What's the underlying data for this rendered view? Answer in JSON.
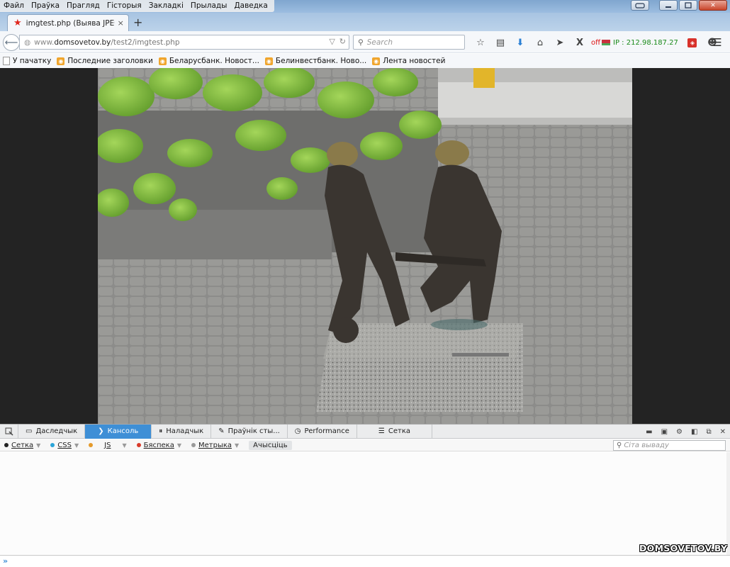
{
  "menu": {
    "items": [
      "Файл",
      "Праўка",
      "Прагляд",
      "Гісторыя",
      "Закладкі",
      "Прылады",
      "Даведка"
    ]
  },
  "tab": {
    "title": "imgtest.php (Выява JPEG, ...",
    "close": "×",
    "new_tab": "+"
  },
  "urlbar": {
    "host_prefix": "www.",
    "host": "domsovetov.by",
    "path": "/test2/imgtest.php"
  },
  "search": {
    "placeholder": "Search"
  },
  "toolbar": {
    "off_label": "off",
    "ip_label": "IP : 212.98.187.27"
  },
  "bookmarks": [
    {
      "label": "У пачатку",
      "icon": "page-icon"
    },
    {
      "label": "Последние заголовки",
      "icon": "rss-icon"
    },
    {
      "label": "Беларусбанк. Новост...",
      "icon": "rss-icon"
    },
    {
      "label": "Белинвестбанк. Ново...",
      "icon": "rss-icon"
    },
    {
      "label": "Лента новостей",
      "icon": "rss-icon"
    }
  ],
  "image": {
    "subject": "bronze statue of two firefighter dwarves carrying a hose on a granite base",
    "colors": {
      "leaves": "#7fb83a",
      "bronze": "#3a3530",
      "granite": "#9a9a98",
      "pavement": "#8a8a88"
    }
  },
  "devtools": {
    "tabs": [
      {
        "label": "Даследчык",
        "icon": "inspector-icon"
      },
      {
        "label": "Кансоль",
        "icon": "console-icon",
        "active": true
      },
      {
        "label": "Наладчык",
        "icon": "debugger-icon"
      },
      {
        "label": "Праўнік сты...",
        "icon": "style-editor-icon"
      },
      {
        "label": "Performance",
        "icon": "performance-icon"
      },
      {
        "label": "Сетка",
        "icon": "network-icon"
      }
    ],
    "filters": [
      {
        "label": "Сетка",
        "color": "#222222"
      },
      {
        "label": "CSS",
        "color": "#2aa4d8"
      },
      {
        "label": "JS",
        "color": "#e49a2a"
      },
      {
        "label": "Бяспека",
        "color": "#d83a2a"
      },
      {
        "label": "Метрыка",
        "color": "#999999"
      }
    ],
    "clear_label": "Ачысціць",
    "filter_placeholder": "Сіта вываду",
    "prompt": "»"
  },
  "watermark": "DOMSOVETOV.BY",
  "accent": "#3e8fd6"
}
